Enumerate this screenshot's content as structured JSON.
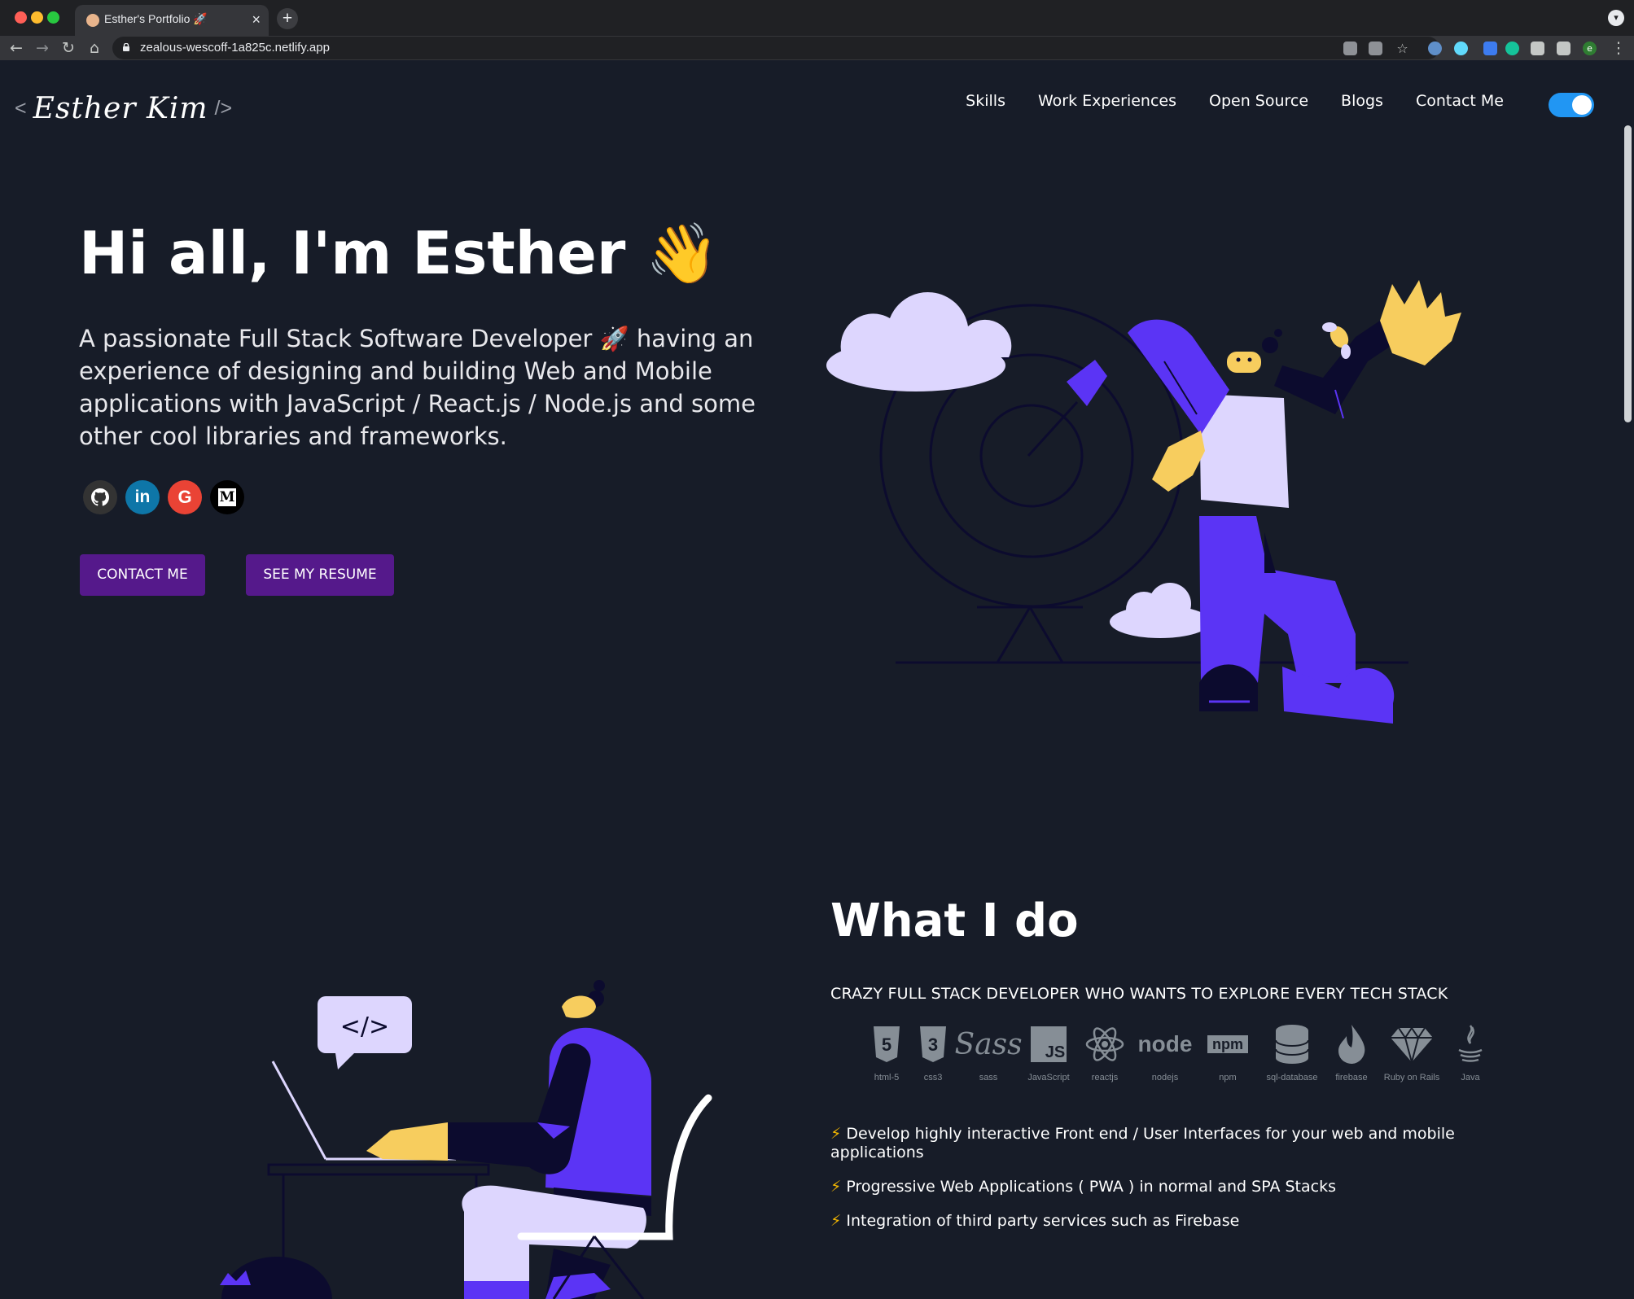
{
  "browser": {
    "tab_title": "Esther's Portfolio 🚀",
    "tab_close": "×",
    "new_tab": "+",
    "url": "zealous-wescoff-1a825c.netlify.app",
    "back": "←",
    "forward": "→",
    "reload": "↻",
    "home": "⌂",
    "menu": "⋮",
    "tab_menu": "▾",
    "profile_letter": "e"
  },
  "header": {
    "logo_open": "<",
    "logo_signature": "Esther Kim",
    "logo_close": "/>",
    "nav": [
      {
        "label": "Skills"
      },
      {
        "label": "Work Experiences"
      },
      {
        "label": "Open Source"
      },
      {
        "label": "Blogs"
      },
      {
        "label": "Contact Me"
      }
    ],
    "dark_mode": true
  },
  "greeting": {
    "title": "Hi all, I'm Esther 👋",
    "subtitle": "A passionate Full Stack Software Developer 🚀 having an experience of designing and building Web and Mobile applications with JavaScript / React.js / Node.js and some other cool libraries and frameworks.",
    "socials": [
      {
        "name": "github",
        "icon": "github-icon",
        "color": "#333333"
      },
      {
        "name": "linkedin",
        "icon": "linkedin-icon",
        "color": "#0e76a8"
      },
      {
        "name": "google",
        "icon": "google-icon",
        "color": "#ea4335"
      },
      {
        "name": "medium",
        "icon": "medium-icon",
        "color": "#000000"
      }
    ],
    "contact_button": "CONTACT ME",
    "resume_button": "SEE MY RESUME"
  },
  "skills_section": {
    "title": "What I do",
    "subtitle": "CRAZY FULL STACK DEVELOPER WHO WANTS TO EXPLORE EVERY TECH STACK",
    "code_bubble": "</>",
    "skills": [
      {
        "label": "html-5",
        "icon": "html5-icon"
      },
      {
        "label": "css3",
        "icon": "css3-icon"
      },
      {
        "label": "sass",
        "icon": "sass-icon"
      },
      {
        "label": "JavaScript",
        "icon": "javascript-icon"
      },
      {
        "label": "reactjs",
        "icon": "react-icon"
      },
      {
        "label": "nodejs",
        "icon": "node-icon"
      },
      {
        "label": "npm",
        "icon": "npm-icon"
      },
      {
        "label": "sql-database",
        "icon": "database-icon"
      },
      {
        "label": "firebase",
        "icon": "firebase-icon"
      },
      {
        "label": "Ruby on Rails",
        "icon": "ruby-icon"
      },
      {
        "label": "Java",
        "icon": "java-icon"
      }
    ],
    "bullets": [
      "Develop highly interactive Front end / User Interfaces for your web and mobile applications",
      "Progressive Web Applications ( PWA ) in normal and SPA Stacks",
      "Integration of third party services such as Firebase"
    ],
    "bolt": "⚡"
  },
  "colors": {
    "background": "#171c28",
    "accent_button": "#55198b",
    "illustration_purple": "#5b34f5",
    "illustration_lavender": "#ddd6fe",
    "illustration_yellow": "#f7cd5e",
    "illustration_navy": "#0c0b2e"
  }
}
